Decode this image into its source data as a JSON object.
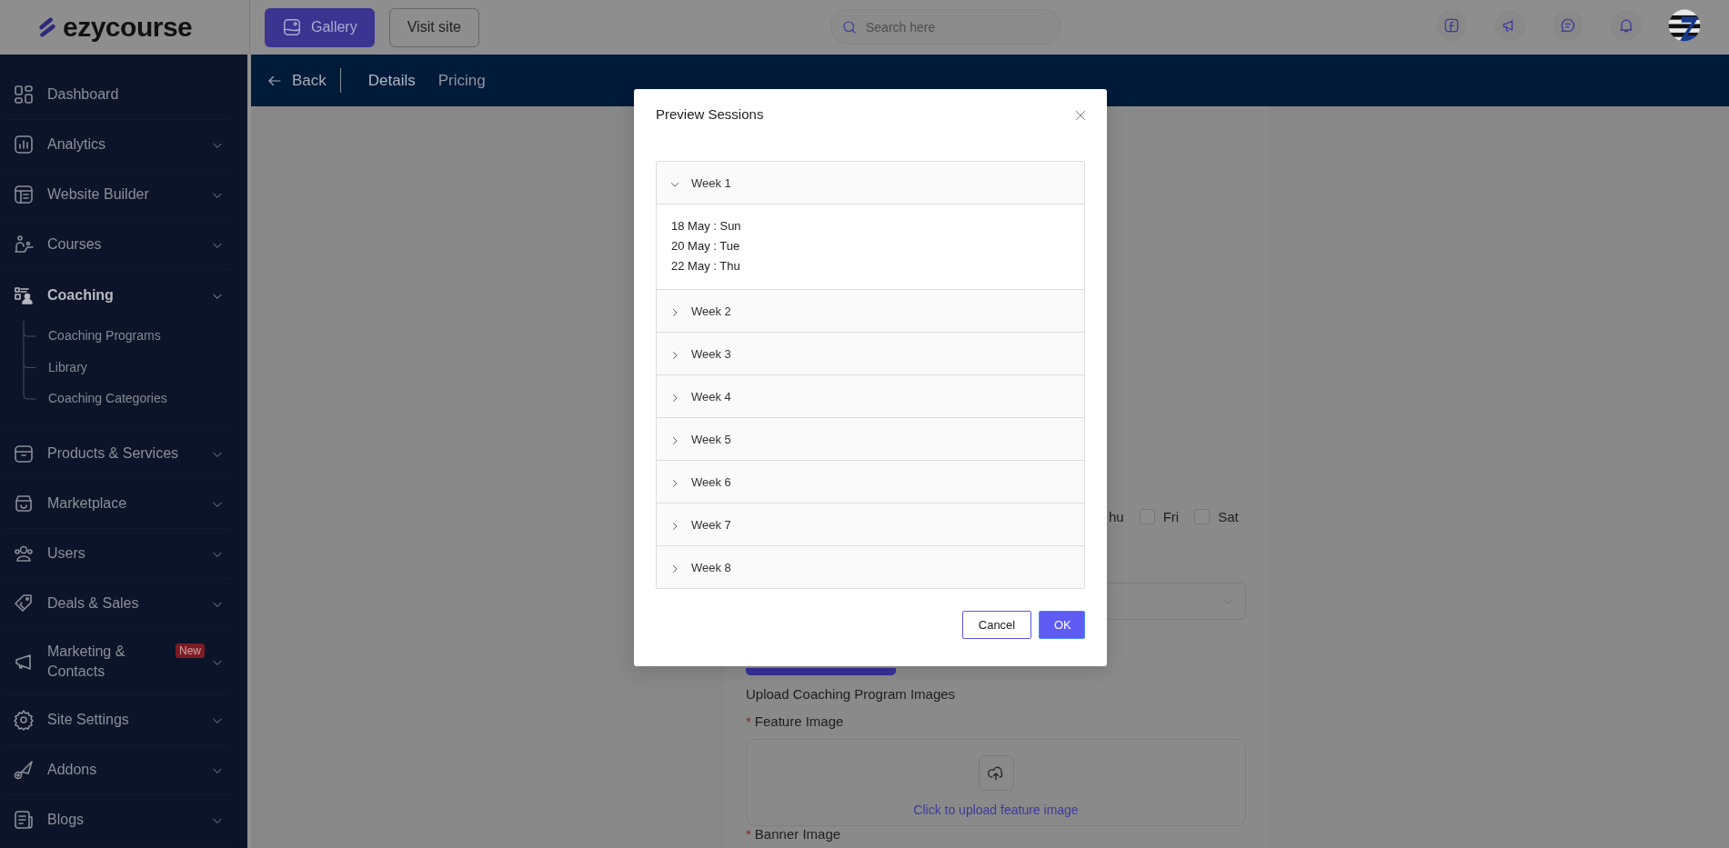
{
  "top_bar": {
    "logo": "ezycourse",
    "buttons": [
      {
        "label": "Gallery",
        "kind": "primary"
      },
      {
        "label": "Visit site",
        "kind": "outline"
      }
    ],
    "search": {
      "placeholder": "Search here"
    }
  },
  "sidebar": {
    "items": [
      {
        "label": "Dashboard",
        "kind": "link",
        "selected": false
      },
      {
        "label": "Analytics",
        "kind": "menu",
        "selected": false
      },
      {
        "label": "Website Builder",
        "kind": "menu",
        "selected": false
      },
      {
        "label": "Courses",
        "kind": "menu",
        "selected": false
      },
      {
        "label": "Coaching",
        "kind": "menu",
        "selected": true,
        "children": [
          {
            "label": "Coaching Programs"
          },
          {
            "label": "Library"
          },
          {
            "label": "Coaching Categories"
          }
        ]
      },
      {
        "label": "Products & Services",
        "kind": "menu",
        "selected": false
      },
      {
        "label": "Marketplace",
        "kind": "menu",
        "selected": false
      },
      {
        "label": "Users",
        "kind": "menu",
        "selected": false
      },
      {
        "label": "Deals & Sales",
        "kind": "menu",
        "selected": false
      },
      {
        "label": "Marketing & Contacts",
        "kind": "menu",
        "selected": false,
        "badge": "New"
      },
      {
        "label": "Site Settings",
        "kind": "menu",
        "selected": false
      },
      {
        "label": "Addons",
        "kind": "menu",
        "selected": false
      },
      {
        "label": "Blogs",
        "kind": "menu",
        "selected": false
      }
    ]
  },
  "subnav": {
    "back": "Back",
    "tabs": [
      {
        "label": "Details",
        "selected": true
      },
      {
        "label": "Pricing",
        "selected": false
      }
    ]
  },
  "form": {
    "days_cut_label": "hu",
    "days": [
      {
        "label": "Fri",
        "checked": false
      },
      {
        "label": "Sat",
        "checked": false
      }
    ],
    "upload_heading": "Upload Coaching Program Images",
    "images": [
      {
        "label": "Feature Image",
        "required_mark": "*",
        "upload_text": "Click to upload feature image"
      },
      {
        "label": "Banner Image",
        "required_mark": "*"
      }
    ]
  },
  "modal": {
    "title": "Preview Sessions",
    "weeks": [
      {
        "label": "Week 1",
        "expanded": true,
        "sessions": [
          "18 May : Sun",
          "20 May : Tue",
          "22 May : Thu"
        ]
      },
      {
        "label": "Week 2",
        "expanded": false
      },
      {
        "label": "Week 3",
        "expanded": false
      },
      {
        "label": "Week 4",
        "expanded": false
      },
      {
        "label": "Week 5",
        "expanded": false
      },
      {
        "label": "Week 6",
        "expanded": false
      },
      {
        "label": "Week 7",
        "expanded": false
      },
      {
        "label": "Week 8",
        "expanded": false
      }
    ],
    "buttons": [
      {
        "label": "Cancel",
        "kind": "secondary"
      },
      {
        "label": "OK",
        "kind": "primary"
      }
    ]
  }
}
